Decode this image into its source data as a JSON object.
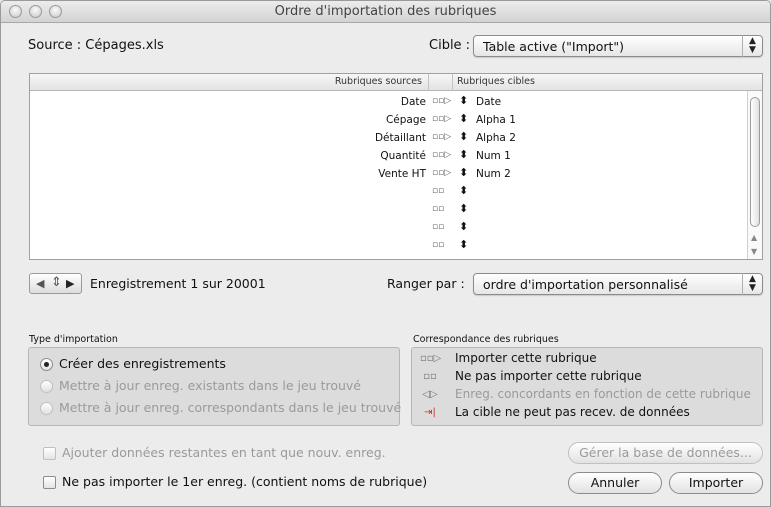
{
  "window": {
    "title": "Ordre d'importation des rubriques"
  },
  "source": {
    "label": "Source : ",
    "file": "Cépages.xls"
  },
  "target": {
    "label": "Cible :",
    "selected": "Table active (\"Import\")"
  },
  "table": {
    "headers": {
      "source": "Rubriques sources",
      "target": "Rubriques cibles"
    },
    "rows": [
      {
        "source": "Date",
        "map": "▫▫▷",
        "target": "Date"
      },
      {
        "source": "Cépage",
        "map": "▫▫▷",
        "target": "Alpha 1"
      },
      {
        "source": "Détaillant",
        "map": "▫▫▷",
        "target": "Alpha 2"
      },
      {
        "source": "Quantité",
        "map": "▫▫▷",
        "target": "Num 1"
      },
      {
        "source": "Vente HT",
        "map": "▫▫▷",
        "target": "Num 2"
      },
      {
        "source": "",
        "map": "▫▫",
        "target": ""
      },
      {
        "source": "",
        "map": "▫▫",
        "target": ""
      },
      {
        "source": "",
        "map": "▫▫",
        "target": ""
      },
      {
        "source": "",
        "map": "▫▫",
        "target": ""
      }
    ]
  },
  "record": {
    "text": "Enregistrement 1 sur 20001"
  },
  "sort": {
    "label": "Ranger par :",
    "selected": "ordre d'importation personnalisé"
  },
  "import_type": {
    "title": "Type d'importation",
    "options": [
      {
        "label": "Créer des enregistrements",
        "selected": true,
        "enabled": true
      },
      {
        "label": "Mettre à jour enreg. existants dans le jeu trouvé",
        "selected": false,
        "enabled": false
      },
      {
        "label": "Mettre à jour enreg. correspondants dans le jeu trouvé",
        "selected": false,
        "enabled": false
      }
    ]
  },
  "mapping_legend": {
    "title": "Correspondance des rubriques",
    "items": [
      {
        "icon": "▫▫▷",
        "label": "Importer cette rubrique",
        "enabled": true
      },
      {
        "icon": "▫▫",
        "label": "Ne pas importer cette rubrique",
        "enabled": true
      },
      {
        "icon": "◁▷",
        "label": "Enreg. concordants en fonction de cette rubrique",
        "enabled": false
      },
      {
        "icon": "⇥|",
        "label": "La cible ne peut pas recev. de données",
        "enabled": true
      }
    ]
  },
  "options": {
    "add_remaining": "Ajouter données restantes en tant que nouv. enreg.",
    "skip_first": "Ne pas importer le 1er enreg. (contient noms de rubrique)"
  },
  "buttons": {
    "manage_db": "Gérer la base de données...",
    "cancel": "Annuler",
    "import": "Importer"
  },
  "colors": {
    "accent": "#4a90d9",
    "legend_red": "#c0392b"
  }
}
